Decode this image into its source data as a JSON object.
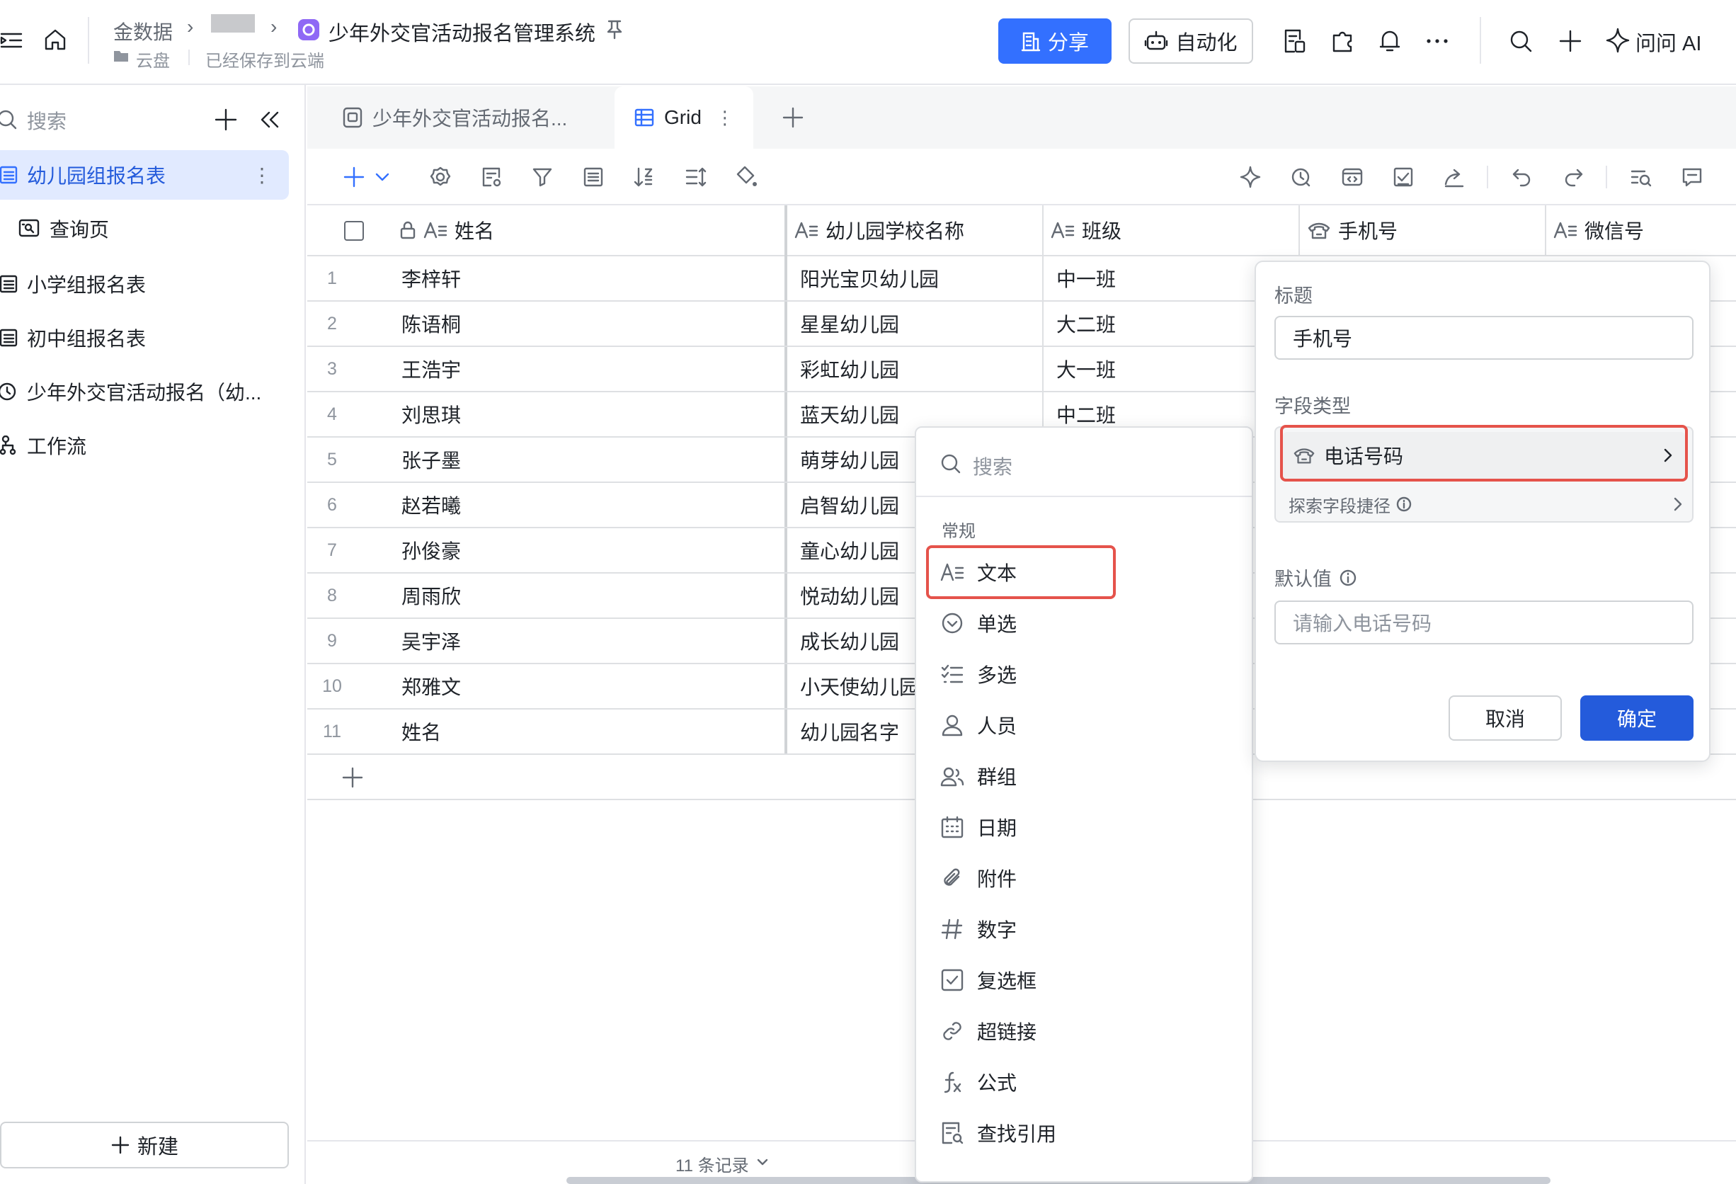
{
  "topbar": {
    "breadcrumb_root": "金数据",
    "app_title": "少年外交官活动报名管理系统",
    "location": "云盘",
    "save_status": "已经保存到云端",
    "share_label": "分享",
    "automation_label": "自动化",
    "ask_ai_label": "问问 AI",
    "accent_color": "#3370ff",
    "app_icon_color": "#8f68f5"
  },
  "sidebar": {
    "search_placeholder": "搜索",
    "items": [
      {
        "label": "幼儿园组报名表",
        "icon": "table-icon",
        "active": true
      },
      {
        "label": "查询页",
        "icon": "query-page-icon",
        "active": false
      },
      {
        "label": "小学组报名表",
        "icon": "table-icon",
        "active": false
      },
      {
        "label": "初中组报名表",
        "icon": "table-icon",
        "active": false
      },
      {
        "label": "少年外交官活动报名（幼...",
        "icon": "form-icon",
        "active": false
      },
      {
        "label": "工作流",
        "icon": "workflow-icon",
        "active": false
      }
    ],
    "new_label": "新建"
  },
  "tabs": {
    "form_tab": "少年外交官活动报名...",
    "grid_tab": "Grid"
  },
  "grid": {
    "columns": [
      {
        "label": "姓名",
        "icon": "text-icon",
        "locked": true
      },
      {
        "label": "幼儿园学校名称",
        "icon": "text-icon"
      },
      {
        "label": "班级",
        "icon": "text-icon"
      },
      {
        "label": "手机号",
        "icon": "phone-icon"
      },
      {
        "label": "微信号",
        "icon": "text-icon"
      }
    ],
    "rows": [
      {
        "n": "1",
        "name": "李梓轩",
        "school": "阳光宝贝幼儿园",
        "class": "中一班"
      },
      {
        "n": "2",
        "name": "陈语桐",
        "school": "星星幼儿园",
        "class": "大二班"
      },
      {
        "n": "3",
        "name": "王浩宇",
        "school": "彩虹幼儿园",
        "class": "大一班"
      },
      {
        "n": "4",
        "name": "刘思琪",
        "school": "蓝天幼儿园",
        "class": "中二班"
      },
      {
        "n": "5",
        "name": "张子墨",
        "school": "萌芽幼儿园",
        "class": ""
      },
      {
        "n": "6",
        "name": "赵若曦",
        "school": "启智幼儿园",
        "class": ""
      },
      {
        "n": "7",
        "name": "孙俊豪",
        "school": "童心幼儿园",
        "class": ""
      },
      {
        "n": "8",
        "name": "周雨欣",
        "school": "悦动幼儿园",
        "class": ""
      },
      {
        "n": "9",
        "name": "吴宇泽",
        "school": "成长幼儿园",
        "class": ""
      },
      {
        "n": "10",
        "name": "郑雅文",
        "school": "小天使幼儿园",
        "class": ""
      },
      {
        "n": "11",
        "name": "姓名",
        "school": "幼儿园名字",
        "class": ""
      }
    ],
    "record_count": "11 条记录"
  },
  "type_menu": {
    "search_placeholder": "搜索",
    "section_label": "常规",
    "items": [
      {
        "label": "文本",
        "icon": "text-icon",
        "highlighted": true
      },
      {
        "label": "单选",
        "icon": "single-select-icon"
      },
      {
        "label": "多选",
        "icon": "multi-select-icon"
      },
      {
        "label": "人员",
        "icon": "person-icon"
      },
      {
        "label": "群组",
        "icon": "group-icon"
      },
      {
        "label": "日期",
        "icon": "calendar-icon"
      },
      {
        "label": "附件",
        "icon": "attachment-icon"
      },
      {
        "label": "数字",
        "icon": "number-icon"
      },
      {
        "label": "复选框",
        "icon": "checkbox-icon"
      },
      {
        "label": "超链接",
        "icon": "link-icon"
      },
      {
        "label": "公式",
        "icon": "formula-icon"
      },
      {
        "label": "查找引用",
        "icon": "lookup-icon"
      }
    ]
  },
  "field_panel": {
    "title_label": "标题",
    "title_value": "手机号",
    "type_label": "字段类型",
    "type_value": "电话号码",
    "explore_label": "探索字段捷径",
    "default_label": "默认值",
    "default_placeholder": "请输入电话号码",
    "cancel_label": "取消",
    "ok_label": "确定",
    "highlight_color": "#e5534b"
  }
}
